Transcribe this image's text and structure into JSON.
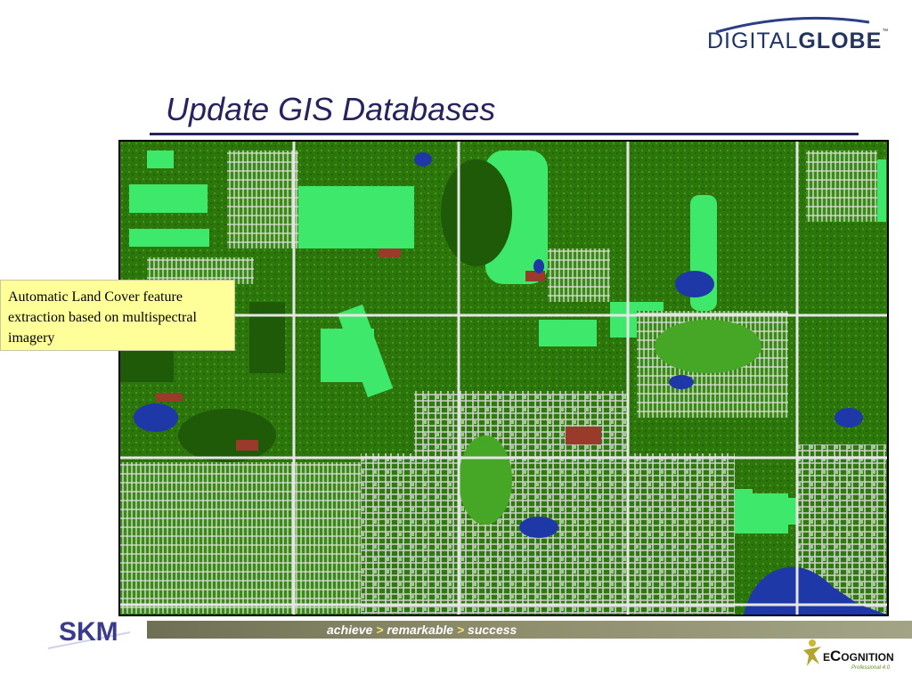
{
  "slide": {
    "title": "Update GIS Databases",
    "callout_text": "Automatic Land Cover feature extraction based on multispectral imagery"
  },
  "header_logo": {
    "text_part1": "DIGITAL",
    "text_part2": "GLOBE",
    "trademark": "™"
  },
  "footer": {
    "logo_text": "SKM",
    "tagline": {
      "word1": "achieve",
      "word2": "remarkable",
      "word3": "success",
      "separator": ">"
    },
    "product_logo_text": "eCognition",
    "product_version_text": "Professional 4.0"
  },
  "colors": {
    "title": "#26235f",
    "callout_background": "#ffff9a",
    "map_vegetation": "#2f7a0d",
    "map_light_vegetation": "#3ee86a",
    "map_water": "#1f38a8",
    "map_bare_soil": "#9a3a2a",
    "map_urban": "#c8c8c8",
    "footer_bar": "#8d8d6c",
    "tagline_separator": "#f4e36c"
  }
}
